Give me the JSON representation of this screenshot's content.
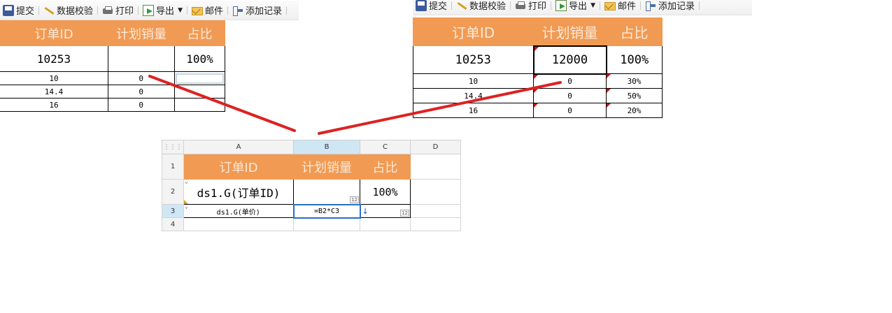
{
  "toolbar": {
    "submit": "提交",
    "validate": "数据校验",
    "print": "打印",
    "export": "导出",
    "mail": "邮件",
    "add_record": "添加记录"
  },
  "headers": {
    "order_id": "订单ID",
    "planned_sales": "计划销量",
    "ratio": "占比"
  },
  "left_report": {
    "order_id": "10253",
    "planned": "",
    "ratio": "100%",
    "rows": [
      {
        "price": "10",
        "sales": "0",
        "ratio": ""
      },
      {
        "price": "14.4",
        "sales": "0",
        "ratio": ""
      },
      {
        "price": "16",
        "sales": "0",
        "ratio": ""
      }
    ]
  },
  "right_report": {
    "order_id": "10253",
    "planned": "12000",
    "ratio": "100%",
    "rows": [
      {
        "price": "10",
        "sales": "0",
        "ratio": "30%"
      },
      {
        "price": "14.4",
        "sales": "0",
        "ratio": "50%"
      },
      {
        "price": "16",
        "sales": "0",
        "ratio": "20%"
      }
    ]
  },
  "designer": {
    "columns": [
      "A",
      "B",
      "C",
      "D"
    ],
    "rows": [
      "1",
      "2",
      "3",
      "4"
    ],
    "a2": "ds1.G(订单ID)",
    "c2": "100%",
    "a3": "ds1.G(单价)",
    "b3": "=B2*C3",
    "badge": "12"
  },
  "colors": {
    "header_orange": "#f19a53",
    "arrow_red": "#dd2222",
    "selection": "#cfe6f5"
  }
}
